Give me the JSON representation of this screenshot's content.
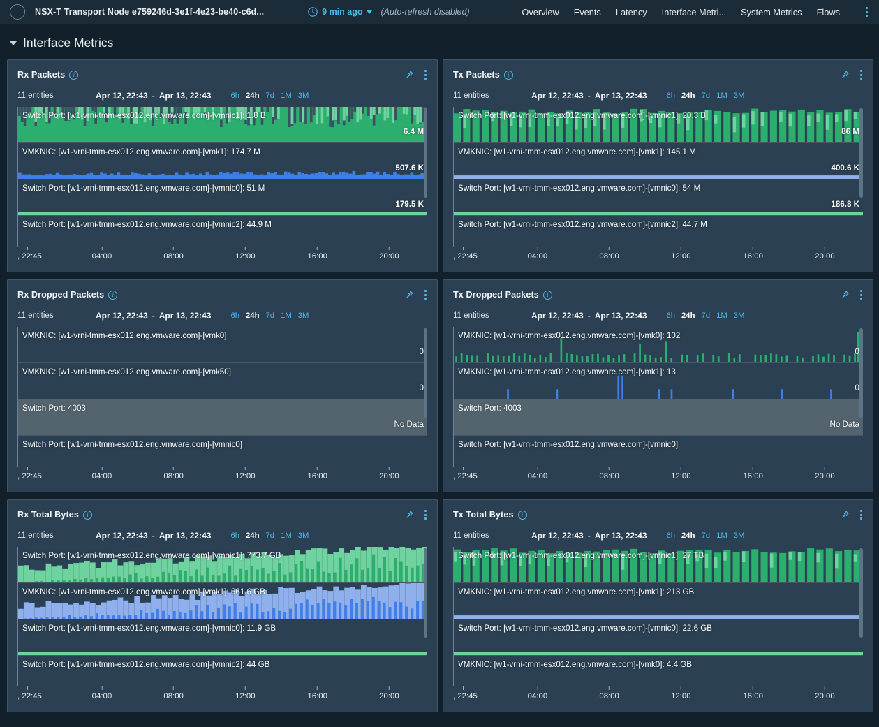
{
  "header": {
    "avatar_icon": "circle-avatar",
    "title": "NSX-T Transport Node e759246d-3e1f-4e23-be40-c6d...",
    "clock_icon": "clock-icon",
    "refresh_label": "9 min ago",
    "caret_icon": "chevron-down-icon",
    "autorefresh": "(Auto-refresh  disabled)",
    "nav": [
      {
        "label": "Overview"
      },
      {
        "label": "Events"
      },
      {
        "label": "Latency"
      },
      {
        "label": "Interface Metri..."
      },
      {
        "label": "System Metrics"
      },
      {
        "label": "Flows"
      }
    ],
    "kebab_icon": "more-vertical-icon"
  },
  "section": {
    "chevron_icon": "chevron-down-icon",
    "title": "Interface Metrics"
  },
  "common": {
    "info_icon": "info-icon",
    "pin_icon": "pin-icon",
    "kebab_icon": "more-vertical-icon",
    "entities": "11 entities",
    "date_start": "Apr 12, 22:43",
    "date_dash": "-",
    "date_end": "Apr 13, 22:43",
    "ranges": [
      "6h",
      "24h",
      "7d",
      "1M",
      "3M"
    ],
    "active_range": "24h",
    "axis_ticks": [
      ", 22:45",
      "04:00",
      "08:00",
      "12:00",
      "16:00",
      "20:00"
    ],
    "no_data": "No Data"
  },
  "colors": {
    "green_dark": "#2cae6e",
    "green_light": "#6fd3a0",
    "blue_dark": "#3f7fe8",
    "blue_light": "#8fb0ec",
    "accent": "#4ab8e8",
    "panel_bg": "#2b4052",
    "page_bg": "#12202b",
    "nodata_bg": "#53646f"
  },
  "panels": [
    {
      "title": "Rx Packets",
      "rows": [
        {
          "label": "Switch Port: [w1-vrni-tmm-esx012.eng.vmware.com]-[vmnic1]: 1.8 B",
          "value": "6.4 M",
          "style": "dense-green",
          "color": "green"
        },
        {
          "label": "VMKNIC: [w1-vrni-tmm-esx012.eng.vmware.com]-[vmk1]: 174.7 M",
          "value": "507.6 K",
          "style": "low-blue",
          "color": "blue"
        },
        {
          "label": "Switch Port: [w1-vrni-tmm-esx012.eng.vmware.com]-[vmnic0]: 51 M",
          "value": "179.5 K",
          "style": "flat-green",
          "color": "green"
        },
        {
          "label": "Switch Port: [w1-vrni-tmm-esx012.eng.vmware.com]-[vmnic2]: 44.9 M",
          "value": "",
          "style": "clipped",
          "color": "green"
        }
      ]
    },
    {
      "title": "Tx Packets",
      "rows": [
        {
          "label": "Switch Port: [w1-vrni-tmm-esx012.eng.vmware.com]-[vmnic1]: 20.3 B",
          "value": "86 M",
          "style": "block-green",
          "color": "green"
        },
        {
          "label": "VMKNIC: [w1-vrni-tmm-esx012.eng.vmware.com]-[vmk1]: 145.1 M",
          "value": "400.6 K",
          "style": "flat-blue",
          "color": "blue"
        },
        {
          "label": "Switch Port: [w1-vrni-tmm-esx012.eng.vmware.com]-[vmnic0]: 54 M",
          "value": "186.8 K",
          "style": "flat-green",
          "color": "green"
        },
        {
          "label": "Switch Port: [w1-vrni-tmm-esx012.eng.vmware.com]-[vmnic2]: 44.7 M",
          "value": "",
          "style": "clipped",
          "color": "green"
        }
      ]
    },
    {
      "title": "Rx Dropped Packets",
      "rows": [
        {
          "label": "VMKNIC: [w1-vrni-tmm-esx012.eng.vmware.com]-[vmk0]",
          "value": "0",
          "style": "empty",
          "color": "green"
        },
        {
          "label": "VMKNIC: [w1-vrni-tmm-esx012.eng.vmware.com]-[vmk50]",
          "value": "0",
          "style": "empty",
          "color": "green"
        },
        {
          "label": "Switch Port: 4003",
          "value": "No Data",
          "style": "nodata",
          "color": "none"
        },
        {
          "label": "Switch Port: [w1-vrni-tmm-esx012.eng.vmware.com]-[vmnic0]",
          "value": "",
          "style": "clipped",
          "color": "green"
        }
      ]
    },
    {
      "title": "Tx Dropped Packets",
      "rows": [
        {
          "label": "VMKNIC: [w1-vrni-tmm-esx012.eng.vmware.com]-[vmk0]: 102",
          "value": "0",
          "style": "spikes-green",
          "color": "green"
        },
        {
          "label": "VMKNIC: [w1-vrni-tmm-esx012.eng.vmware.com]-[vmk1]: 13",
          "value": "0",
          "style": "spikes-blue",
          "color": "blue"
        },
        {
          "label": "Switch Port: 4003",
          "value": "No Data",
          "style": "nodata",
          "color": "none"
        },
        {
          "label": "Switch Port: [w1-vrni-tmm-esx012.eng.vmware.com]-[vmnic0]",
          "value": "",
          "style": "clipped",
          "color": "green"
        }
      ]
    },
    {
      "title": "Rx Total Bytes",
      "rows": [
        {
          "label": "Switch Port: [w1-vrni-tmm-esx012.eng.vmware.com]-[vmnic1]: 773.7 GB",
          "value": "",
          "style": "ramp-green",
          "color": "green"
        },
        {
          "label": "VMKNIC: [w1-vrni-tmm-esx012.eng.vmware.com]-[vmk1]: 661.6 GB",
          "value": "",
          "style": "ramp-blue",
          "color": "blue"
        },
        {
          "label": "Switch Port: [w1-vrni-tmm-esx012.eng.vmware.com]-[vmnic0]: 11.9 GB",
          "value": "",
          "style": "flat-green",
          "color": "green"
        },
        {
          "label": "Switch Port: [w1-vrni-tmm-esx012.eng.vmware.com]-[vmnic2]: 44 GB",
          "value": "",
          "style": "clipped",
          "color": "green"
        }
      ]
    },
    {
      "title": "Tx Total Bytes",
      "rows": [
        {
          "label": "Switch Port: [w1-vrni-tmm-esx012.eng.vmware.com]-[vmnic1]: 27 TB",
          "value": "",
          "style": "block-green",
          "color": "green"
        },
        {
          "label": "VMKNIC: [w1-vrni-tmm-esx012.eng.vmware.com]-[vmk1]: 213 GB",
          "value": "",
          "style": "flat-blue",
          "color": "blue"
        },
        {
          "label": "Switch Port: [w1-vrni-tmm-esx012.eng.vmware.com]-[vmnic0]: 22.6 GB",
          "value": "",
          "style": "flat-green",
          "color": "green"
        },
        {
          "label": "VMKNIC: [w1-vrni-tmm-esx012.eng.vmware.com]-[vmk0]: 4.4 GB",
          "value": "",
          "style": "clipped",
          "color": "green"
        }
      ]
    }
  ],
  "chart_data": {
    "type": "bar",
    "title": "Interface Metrics sparkline panels",
    "xlabel": "",
    "ylabel": "",
    "grid": false,
    "legend": "none",
    "x_tick_labels": [
      ", 22:45",
      "04:00",
      "08:00",
      "12:00",
      "16:00",
      "20:00"
    ],
    "x_range": [
      "Apr 12, 22:43",
      "Apr 13, 22:43"
    ],
    "series": [
      {
        "panel": "Rx Packets",
        "name": "Switch Port: [w1-vrni-tmm-esx012.eng.vmware.com]-[vmnic1]",
        "total": "1.8 B",
        "peak": "6.4 M",
        "color": "#2cae6e"
      },
      {
        "panel": "Rx Packets",
        "name": "VMKNIC: [w1-vrni-tmm-esx012.eng.vmware.com]-[vmk1]",
        "total": "174.7 M",
        "peak": "507.6 K",
        "color": "#3f7fe8"
      },
      {
        "panel": "Rx Packets",
        "name": "Switch Port: [w1-vrni-tmm-esx012.eng.vmware.com]-[vmnic0]",
        "total": "51 M",
        "peak": "179.5 K",
        "color": "#6fd3a0"
      },
      {
        "panel": "Rx Packets",
        "name": "Switch Port: [w1-vrni-tmm-esx012.eng.vmware.com]-[vmnic2]",
        "total": "44.9 M",
        "peak": "",
        "color": "#2cae6e"
      },
      {
        "panel": "Tx Packets",
        "name": "Switch Port: [w1-vrni-tmm-esx012.eng.vmware.com]-[vmnic1]",
        "total": "20.3 B",
        "peak": "86 M",
        "color": "#2cae6e"
      },
      {
        "panel": "Tx Packets",
        "name": "VMKNIC: [w1-vrni-tmm-esx012.eng.vmware.com]-[vmk1]",
        "total": "145.1 M",
        "peak": "400.6 K",
        "color": "#8fb0ec"
      },
      {
        "panel": "Tx Packets",
        "name": "Switch Port: [w1-vrni-tmm-esx012.eng.vmware.com]-[vmnic0]",
        "total": "54 M",
        "peak": "186.8 K",
        "color": "#6fd3a0"
      },
      {
        "panel": "Tx Packets",
        "name": "Switch Port: [w1-vrni-tmm-esx012.eng.vmware.com]-[vmnic2]",
        "total": "44.7 M",
        "peak": "",
        "color": "#2cae6e"
      },
      {
        "panel": "Rx Dropped Packets",
        "name": "VMKNIC: [w1-vrni-tmm-esx012.eng.vmware.com]-[vmk0]",
        "total": "",
        "peak": "0",
        "color": "#2cae6e"
      },
      {
        "panel": "Rx Dropped Packets",
        "name": "VMKNIC: [w1-vrni-tmm-esx012.eng.vmware.com]-[vmk50]",
        "total": "",
        "peak": "0",
        "color": "#2cae6e"
      },
      {
        "panel": "Rx Dropped Packets",
        "name": "Switch Port: 4003",
        "total": "",
        "peak": "No Data",
        "color": "#53646f"
      },
      {
        "panel": "Tx Dropped Packets",
        "name": "VMKNIC: [w1-vrni-tmm-esx012.eng.vmware.com]-[vmk0]",
        "total": "102",
        "peak": "0",
        "color": "#2cae6e"
      },
      {
        "panel": "Tx Dropped Packets",
        "name": "VMKNIC: [w1-vrni-tmm-esx012.eng.vmware.com]-[vmk1]",
        "total": "13",
        "peak": "0",
        "color": "#3f7fe8"
      },
      {
        "panel": "Tx Dropped Packets",
        "name": "Switch Port: 4003",
        "total": "",
        "peak": "No Data",
        "color": "#53646f"
      },
      {
        "panel": "Rx Total Bytes",
        "name": "Switch Port: [w1-vrni-tmm-esx012.eng.vmware.com]-[vmnic1]",
        "total": "773.7 GB",
        "peak": "",
        "color": "#2cae6e"
      },
      {
        "panel": "Rx Total Bytes",
        "name": "VMKNIC: [w1-vrni-tmm-esx012.eng.vmware.com]-[vmk1]",
        "total": "661.6 GB",
        "peak": "",
        "color": "#3f7fe8"
      },
      {
        "panel": "Rx Total Bytes",
        "name": "Switch Port: [w1-vrni-tmm-esx012.eng.vmware.com]-[vmnic0]",
        "total": "11.9 GB",
        "peak": "",
        "color": "#6fd3a0"
      },
      {
        "panel": "Rx Total Bytes",
        "name": "Switch Port: [w1-vrni-tmm-esx012.eng.vmware.com]-[vmnic2]",
        "total": "44 GB",
        "peak": "",
        "color": "#2cae6e"
      },
      {
        "panel": "Tx Total Bytes",
        "name": "Switch Port: [w1-vrni-tmm-esx012.eng.vmware.com]-[vmnic1]",
        "total": "27 TB",
        "peak": "",
        "color": "#2cae6e"
      },
      {
        "panel": "Tx Total Bytes",
        "name": "VMKNIC: [w1-vrni-tmm-esx012.eng.vmware.com]-[vmk1]",
        "total": "213 GB",
        "peak": "",
        "color": "#8fb0ec"
      },
      {
        "panel": "Tx Total Bytes",
        "name": "Switch Port: [w1-vrni-tmm-esx012.eng.vmware.com]-[vmnic0]",
        "total": "22.6 GB",
        "peak": "",
        "color": "#6fd3a0"
      },
      {
        "panel": "Tx Total Bytes",
        "name": "VMKNIC: [w1-vrni-tmm-esx012.eng.vmware.com]-[vmk0]",
        "total": "4.4 GB",
        "peak": "",
        "color": "#6fd3a0"
      }
    ]
  }
}
